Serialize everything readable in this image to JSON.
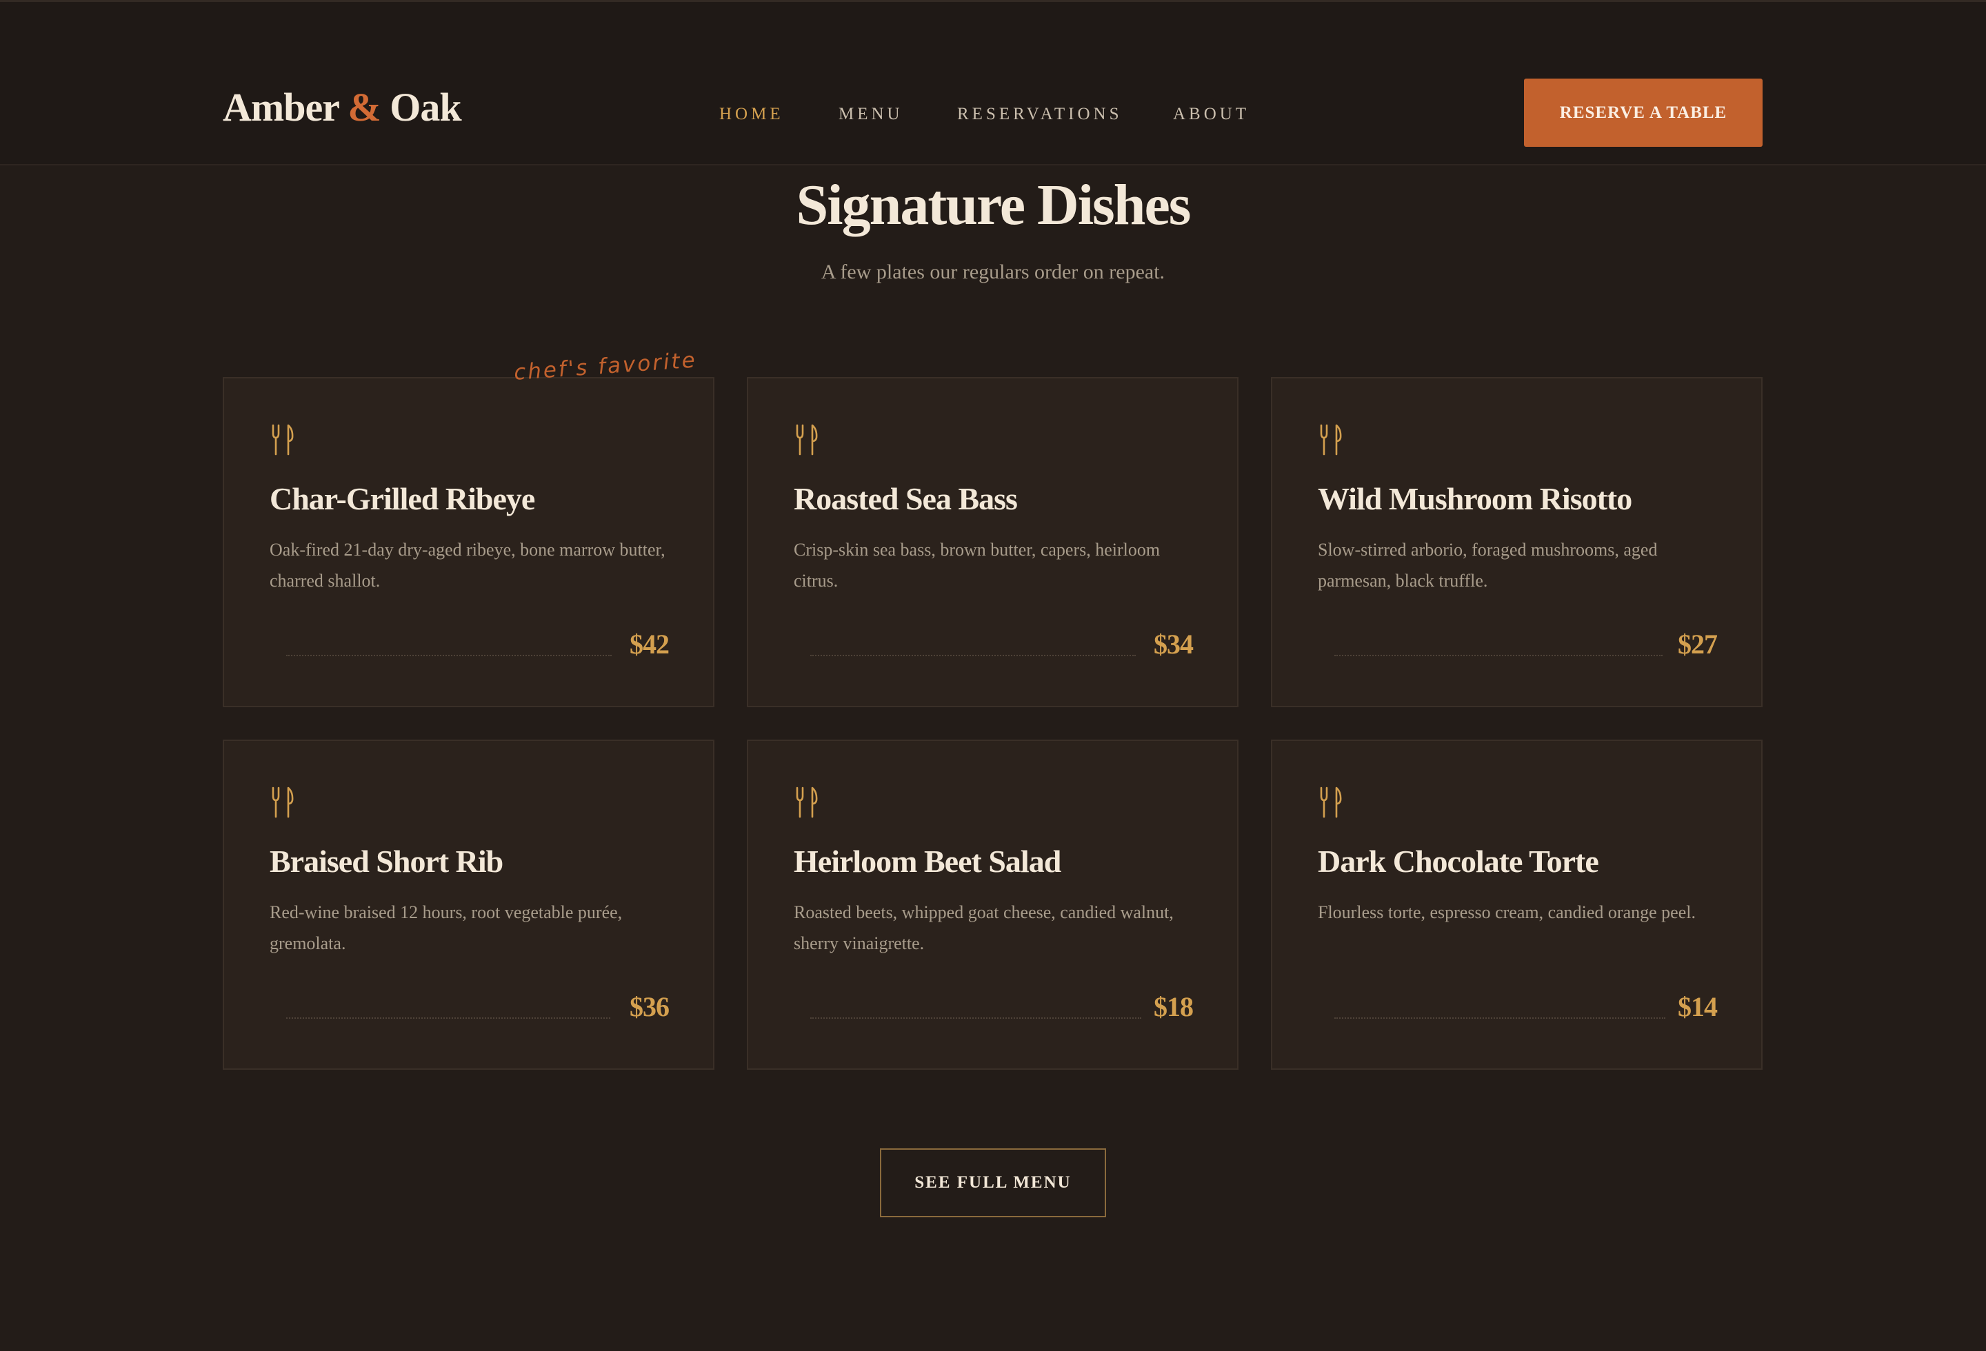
{
  "brand": {
    "name_part1": "Amber",
    "ampersand": "&",
    "name_part2": "Oak"
  },
  "nav": {
    "items": [
      {
        "label": "HOME",
        "active": true
      },
      {
        "label": "MENU",
        "active": false
      },
      {
        "label": "RESERVATIONS",
        "active": false
      },
      {
        "label": "ABOUT",
        "active": false
      }
    ],
    "cta_label": "RESERVE A TABLE"
  },
  "section": {
    "title": "Signature Dishes",
    "subtitle": "A few plates our regulars order on repeat."
  },
  "chef_note": "chef's favorite",
  "dishes": [
    {
      "name": "Char-Grilled Ribeye",
      "description": "Oak-fired 21-day dry-aged ribeye, bone marrow butter, charred shallot.",
      "price": "$42",
      "icon": "fork-knife-icon"
    },
    {
      "name": "Roasted Sea Bass",
      "description": "Crisp-skin sea bass, brown butter, capers, heirloom citrus.",
      "price": "$34",
      "icon": "fork-knife-icon"
    },
    {
      "name": "Wild Mushroom Risotto",
      "description": "Slow-stirred arborio, foraged mushrooms, aged parmesan, black truffle.",
      "price": "$27",
      "icon": "fork-knife-icon"
    },
    {
      "name": "Braised Short Rib",
      "description": "Red-wine braised 12 hours, root vegetable purée, gremolata.",
      "price": "$36",
      "icon": "fork-knife-icon"
    },
    {
      "name": "Heirloom Beet Salad",
      "description": "Roasted beets, whipped goat cheese, candied walnut, sherry vinaigrette.",
      "price": "$18",
      "icon": "fork-knife-icon"
    },
    {
      "name": "Dark Chocolate Torte",
      "description": "Flourless torte, espresso cream, candied orange peel.",
      "price": "$14",
      "icon": "fork-knife-icon"
    }
  ],
  "full_menu_label": "SEE FULL MENU",
  "colors": {
    "background": "#231c18",
    "header": "#1f1916",
    "card": "#2b221c",
    "accent_orange": "#c2612d",
    "accent_gold": "#d4a04f",
    "text_primary": "#f3e8d8",
    "text_muted": "#a89c8b"
  }
}
